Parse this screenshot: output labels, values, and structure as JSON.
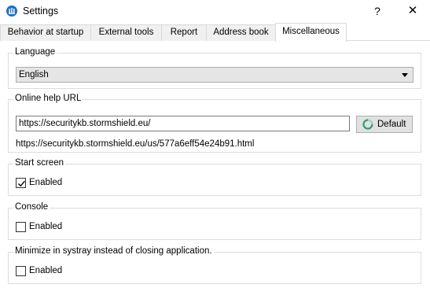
{
  "window": {
    "title": "Settings",
    "help_glyph": "?",
    "close_glyph": "✕",
    "app_icon": "stormshield-app-icon"
  },
  "tabs": [
    {
      "label": "Behavior at startup",
      "active": false
    },
    {
      "label": "External tools",
      "active": false
    },
    {
      "label": "Report",
      "active": false
    },
    {
      "label": "Address book",
      "active": false
    },
    {
      "label": "Miscellaneous",
      "active": true
    }
  ],
  "language": {
    "group_label": "Language",
    "selected": "English"
  },
  "online_help": {
    "group_label": "Online help URL",
    "url_value": "https://securitykb.stormshield.eu/",
    "default_button": "Default",
    "default_icon": "refresh-icon",
    "resolved_url": "https://securitykb.stormshield.eu/us/577a6eff54e24b91.html"
  },
  "start_screen": {
    "group_label": "Start screen",
    "checkbox_label": "Enabled",
    "checked": true
  },
  "console": {
    "group_label": "Console",
    "checkbox_label": "Enabled",
    "checked": false
  },
  "systray": {
    "group_label": "Minimize in systray instead of closing application.",
    "checkbox_label": "Enabled",
    "checked": false
  },
  "colors": {
    "accent": "#1f6fc4",
    "refresh_icon": "#2e9e6e"
  }
}
